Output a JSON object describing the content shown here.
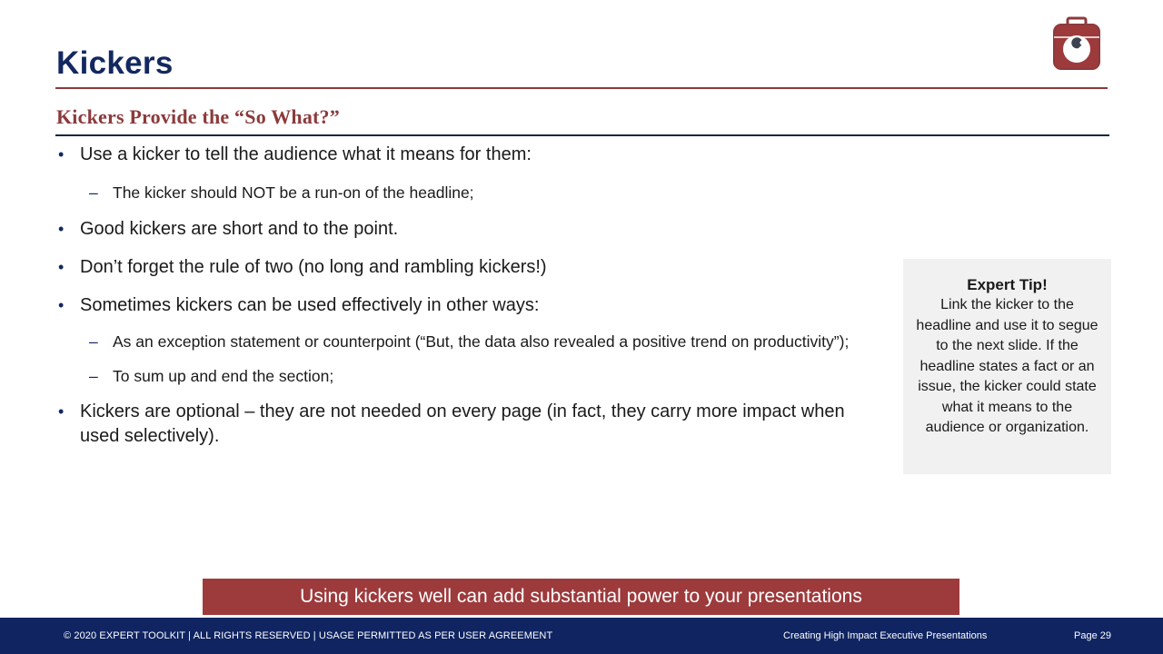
{
  "header": {
    "title": "Kickers",
    "subtitle": "Kickers Provide the “So What?”",
    "logo_icon": "toolbox-wrench-icon"
  },
  "bullets": [
    {
      "level": 1,
      "text": "Use a kicker to tell the audience what it means for them:"
    },
    {
      "level": 2,
      "text": "The kicker should NOT be a run-on of the headline;"
    },
    {
      "level": 1,
      "text": "Good kickers are short and to the point."
    },
    {
      "level": 1,
      "text": "Don’t forget the rule of two (no long and rambling kickers!)"
    },
    {
      "level": 1,
      "text": "Sometimes kickers can be used effectively in other ways:"
    },
    {
      "level": 2,
      "text": "As an exception statement or counterpoint (“But, the data also revealed a positive trend on productivity”);"
    },
    {
      "level": 2,
      "text": "To sum up and end the section;"
    },
    {
      "level": 1,
      "text": "Kickers are optional – they are not needed on every page (in fact, they carry more impact when used selectively)."
    }
  ],
  "tip": {
    "title": "Expert Tip!",
    "body": "Link the kicker to the headline and use it to segue to the next slide. If the headline states a fact or an issue, the kicker could state what it means to the audience or organization."
  },
  "kicker": {
    "text": "Using kickers well can add substantial power to your presentations"
  },
  "footer": {
    "copyright": "© 2020 EXPERT TOOLKIT | ALL RIGHTS RESERVED | USAGE PERMITTED AS PER USER AGREEMENT",
    "deck_title": "Creating High Impact Executive Presentations",
    "page": "Page 29"
  },
  "colors": {
    "navy": "#13285f",
    "maroon": "#8c3a3c",
    "kicker_bg": "#9d3a3c",
    "footer_bg": "#0f2461",
    "tip_bg": "#f1f1f1"
  }
}
